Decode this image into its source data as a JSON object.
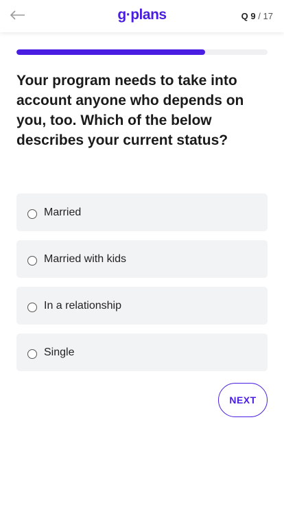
{
  "header": {
    "logo": {
      "part1": "g",
      "dot": "·",
      "part2": "plans"
    },
    "question_current": "9",
    "question_total": "17",
    "question_prefix": "Q"
  },
  "progress": {
    "fraction": 0.75
  },
  "question": {
    "text": "Your program needs to take into account anyone who depends on you, too. Which of the below describes your current status?"
  },
  "options": [
    {
      "label": "Married",
      "selected": false
    },
    {
      "label": "Married with kids",
      "selected": false
    },
    {
      "label": "In a relationship",
      "selected": false
    },
    {
      "label": "Single",
      "selected": false
    }
  ],
  "next_button": {
    "label": "NEXT"
  },
  "colors": {
    "brand": "#4a1de3",
    "option_bg": "#f2f3f5"
  },
  "icons": {
    "back": "arrow-left-icon",
    "radio": "radio-unchecked-icon"
  }
}
